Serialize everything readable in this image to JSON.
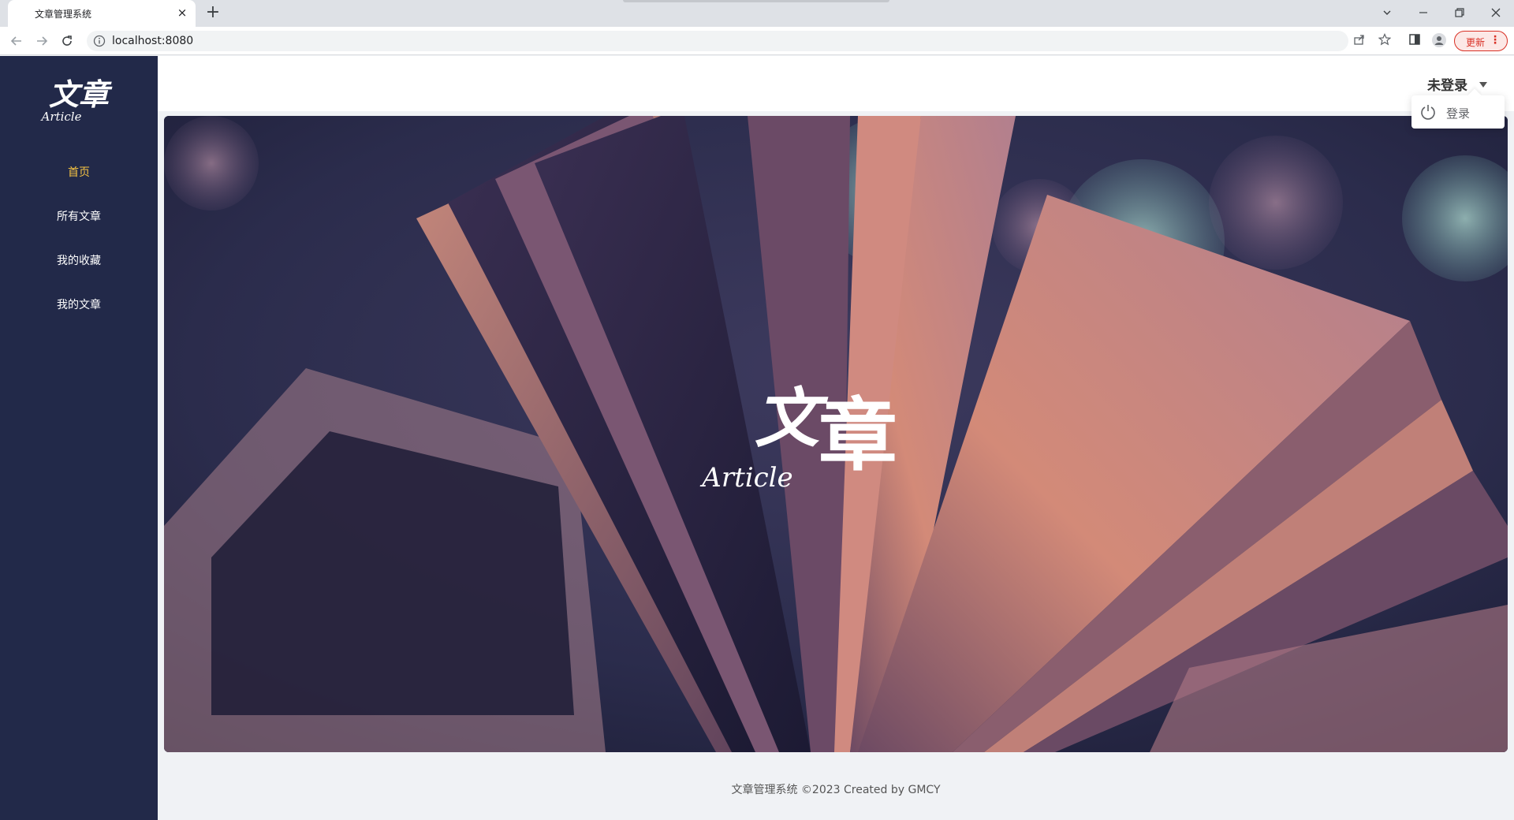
{
  "browser": {
    "tab_title": "文章管理系统",
    "tab_close": "×",
    "new_tab": "+",
    "url": "localhost:8080",
    "update_label": "更新",
    "update_menu": "⋮"
  },
  "sidebar": {
    "logo_main": "文章",
    "logo_sub": "Article",
    "items": [
      {
        "label": "首页",
        "active": true
      },
      {
        "label": "所有文章",
        "active": false
      },
      {
        "label": "我的收藏",
        "active": false
      },
      {
        "label": "我的文章",
        "active": false
      }
    ]
  },
  "header": {
    "user_status": "未登录",
    "dropdown": {
      "login_label": "登录",
      "icon": "power-icon"
    }
  },
  "banner": {
    "logo_main_1": "文",
    "logo_main_2": "章",
    "logo_sub": "Article"
  },
  "footer": {
    "text": "文章管理系统 ©2023 Created by GMCY"
  },
  "colors": {
    "sidebar_bg": "#222949",
    "active_menu": "#f5c242",
    "update_red": "#d93025"
  }
}
